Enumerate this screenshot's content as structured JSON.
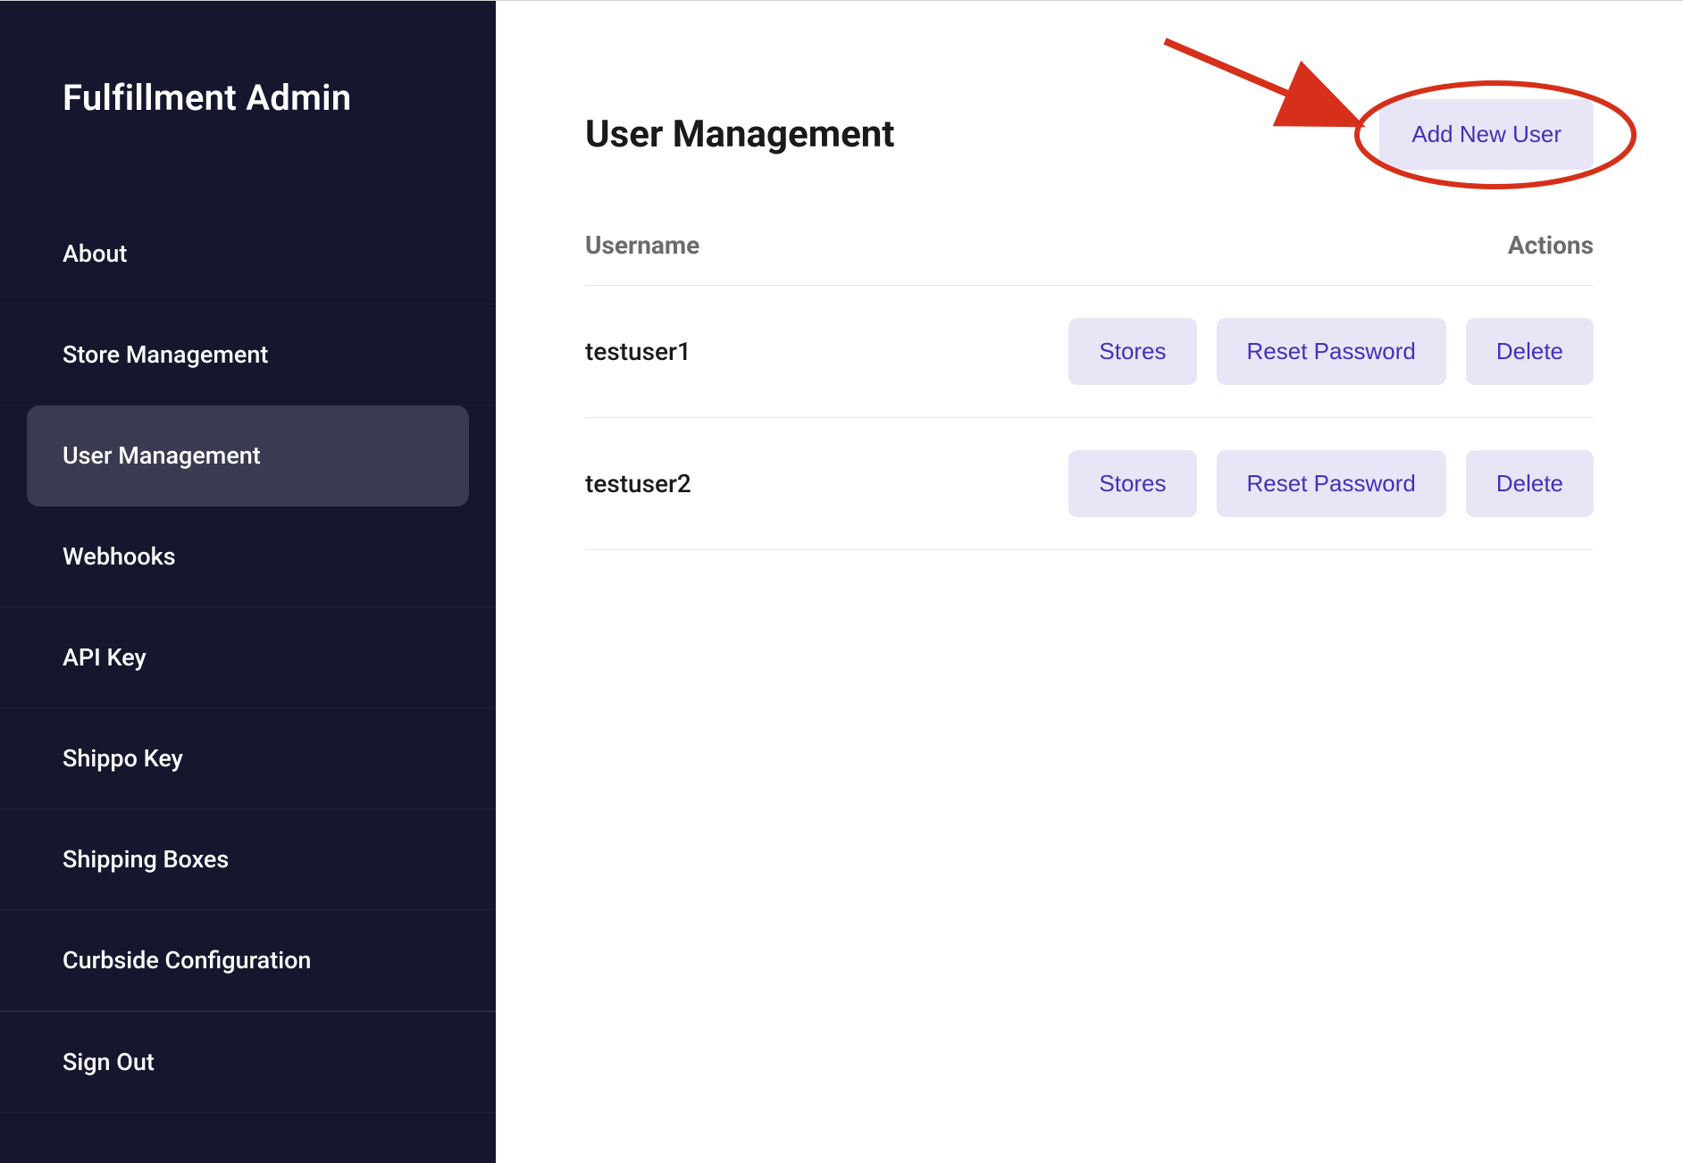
{
  "sidebar": {
    "title": "Fulfillment Admin",
    "items": [
      {
        "label": "About",
        "active": false
      },
      {
        "label": "Store Management",
        "active": false
      },
      {
        "label": "User Management",
        "active": true
      },
      {
        "label": "Webhooks",
        "active": false
      },
      {
        "label": "API Key",
        "active": false
      },
      {
        "label": "Shippo Key",
        "active": false
      },
      {
        "label": "Shipping Boxes",
        "active": false
      },
      {
        "label": "Curbside Configuration",
        "active": false
      },
      {
        "label": "Sign Out",
        "active": false
      }
    ]
  },
  "main": {
    "title": "User Management",
    "add_button_label": "Add New User",
    "table": {
      "headers": {
        "username": "Username",
        "actions": "Actions"
      },
      "action_labels": {
        "stores": "Stores",
        "reset_password": "Reset Password",
        "delete": "Delete"
      },
      "rows": [
        {
          "username": "testuser1"
        },
        {
          "username": "testuser2"
        }
      ]
    }
  },
  "annotation": {
    "color": "#d62f1a"
  }
}
